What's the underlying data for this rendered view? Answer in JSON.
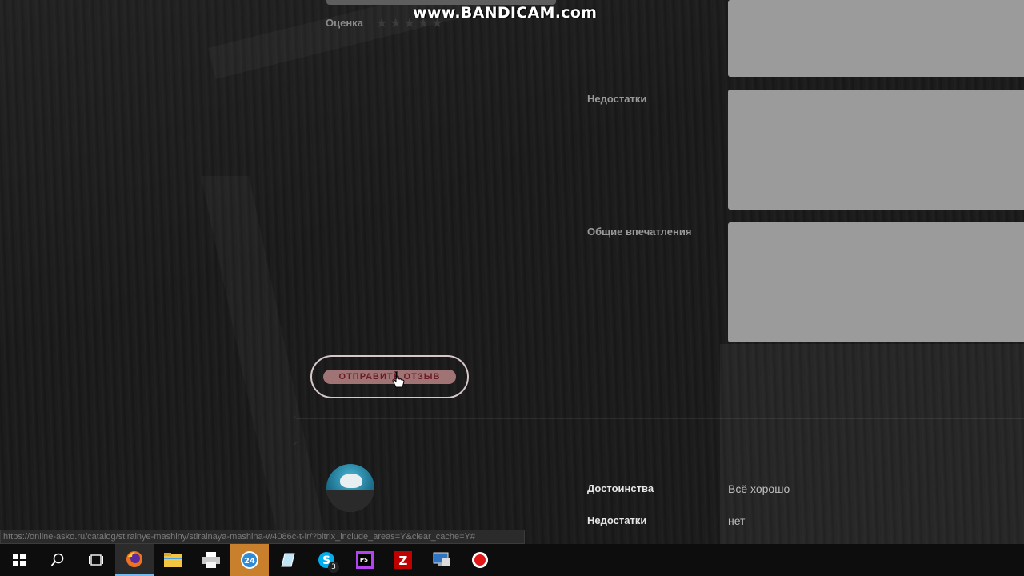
{
  "watermark": "www.BANDICAM.com",
  "review_form": {
    "rating_label": "Оценка",
    "stars": [
      "★",
      "★",
      "★",
      "★",
      "★"
    ],
    "fields": [
      {
        "label": "Недостатки",
        "value": ""
      },
      {
        "label": "Общие впечатления",
        "value": ""
      }
    ],
    "submit_label": "ОТПРАВИТЬ ОТЗЫВ"
  },
  "review": {
    "avatar": "polar-bear-avatar",
    "items": [
      {
        "label": "Достоинства",
        "value": "Всё хорошо"
      },
      {
        "label": "Недостатки",
        "value": "нет"
      }
    ]
  },
  "status_bar": {
    "url": "https://online-asko.ru/catalog/stiralnye-mashiny/stiralnaya-mashina-w4086c-t-ir/?bitrix_include_areas=Y&clear_cache=Y#"
  },
  "taskbar": {
    "items": [
      {
        "name": "windows-start-icon",
        "active": false
      },
      {
        "name": "search-icon",
        "active": false
      },
      {
        "name": "task-view-icon",
        "active": false
      },
      {
        "name": "firefox-icon",
        "active": true
      },
      {
        "name": "file-explorer-icon",
        "active": false
      },
      {
        "name": "printer-icon",
        "active": false
      },
      {
        "name": "clock-24-app-icon",
        "active": false,
        "highlight": true
      },
      {
        "name": "notepad-icon",
        "active": false
      },
      {
        "name": "skype-icon",
        "active": false,
        "badge": "3"
      },
      {
        "name": "phpstorm-icon",
        "active": false
      },
      {
        "name": "filezilla-icon",
        "active": false
      },
      {
        "name": "remote-desktop-icon",
        "active": false
      },
      {
        "name": "bandicam-record-icon",
        "active": false
      }
    ]
  }
}
